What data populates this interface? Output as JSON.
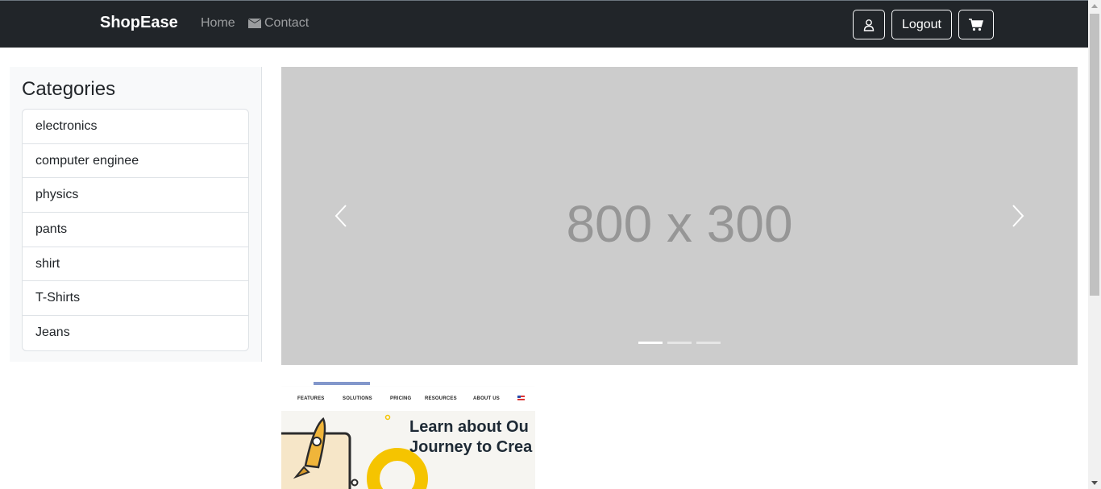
{
  "navbar": {
    "brand": "ShopEase",
    "links": {
      "home": "Home",
      "contact": "Contact"
    },
    "buttons": {
      "logout": "Logout"
    },
    "icons": {
      "contact": "envelope-icon",
      "user": "user-icon",
      "cart": "cart-icon"
    },
    "background": "#212529"
  },
  "sidebar": {
    "title": "Categories",
    "items": [
      {
        "label": "electronics"
      },
      {
        "label": "computer enginee"
      },
      {
        "label": "physics"
      },
      {
        "label": "pants"
      },
      {
        "label": "shirt"
      },
      {
        "label": "T-Shirts"
      },
      {
        "label": "Jeans"
      }
    ]
  },
  "carousel": {
    "placeholder_text": "800 x 300",
    "slide_count": 3,
    "active_index": 0,
    "icons": {
      "prev": "chevron-left-icon",
      "next": "chevron-right-icon"
    },
    "background": "#cccccc"
  },
  "thumbnail": {
    "nav_items": [
      "FEATURES",
      "SOLUTIONS",
      "PRICING",
      "RESOURCES",
      "ABOUT US"
    ],
    "heading_line1": "Learn about Ou",
    "heading_line2": "Journey to Crea",
    "accent": "#f5c400"
  }
}
